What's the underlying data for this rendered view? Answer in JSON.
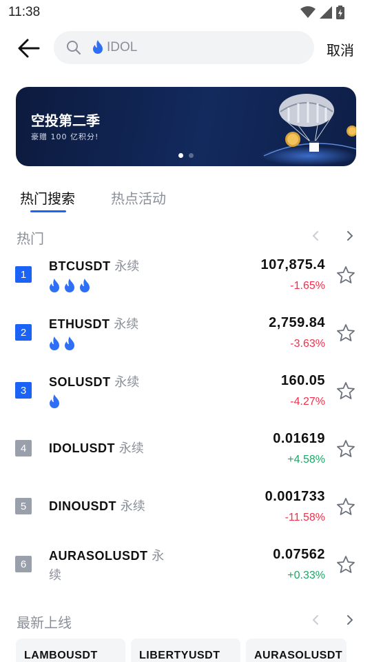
{
  "status_bar": {
    "time": "11:38"
  },
  "search": {
    "placeholder": "IDOL",
    "cancel_label": "取消"
  },
  "banner": {
    "title": "空投第二季",
    "subtitle": "豪赠 100 亿积分!"
  },
  "tabs": [
    {
      "label": "热门搜索",
      "active": true
    },
    {
      "label": "热点活动",
      "active": false
    }
  ],
  "hot": {
    "title": "热门",
    "items": [
      {
        "rank": "1",
        "symbol": "BTCUSDT",
        "type": "永续",
        "flames": 3,
        "price": "107,875.4",
        "change": "-1.65%",
        "direction": "down"
      },
      {
        "rank": "2",
        "symbol": "ETHUSDT",
        "type": "永续",
        "flames": 2,
        "price": "2,759.84",
        "change": "-3.63%",
        "direction": "down"
      },
      {
        "rank": "3",
        "symbol": "SOLUSDT",
        "type": "永续",
        "flames": 1,
        "price": "160.05",
        "change": "-4.27%",
        "direction": "down"
      },
      {
        "rank": "4",
        "symbol": "IDOLUSDT",
        "type": "永续",
        "flames": 0,
        "price": "0.01619",
        "change": "+4.58%",
        "direction": "up"
      },
      {
        "rank": "5",
        "symbol": "DINOUSDT",
        "type": "永续",
        "flames": 0,
        "price": "0.001733",
        "change": "-11.58%",
        "direction": "down"
      },
      {
        "rank": "6",
        "symbol": "AURASOLUSDT",
        "type": "永续",
        "flames": 0,
        "price": "0.07562",
        "change": "+0.33%",
        "direction": "up"
      }
    ]
  },
  "new_listings": {
    "title": "最新上线",
    "items": [
      "LAMBOUSDT",
      "LIBERTYUSDT",
      "AURASOLUSDT"
    ]
  },
  "colors": {
    "accent": "#1a63f5",
    "down": "#f0304c",
    "up": "#1aa864",
    "muted": "#8a8f99"
  },
  "icons": [
    "back-arrow-icon",
    "search-icon",
    "fire-icon",
    "star-icon",
    "chevron-left-icon",
    "chevron-right-icon",
    "wifi-icon",
    "signal-icon",
    "battery-icon"
  ]
}
